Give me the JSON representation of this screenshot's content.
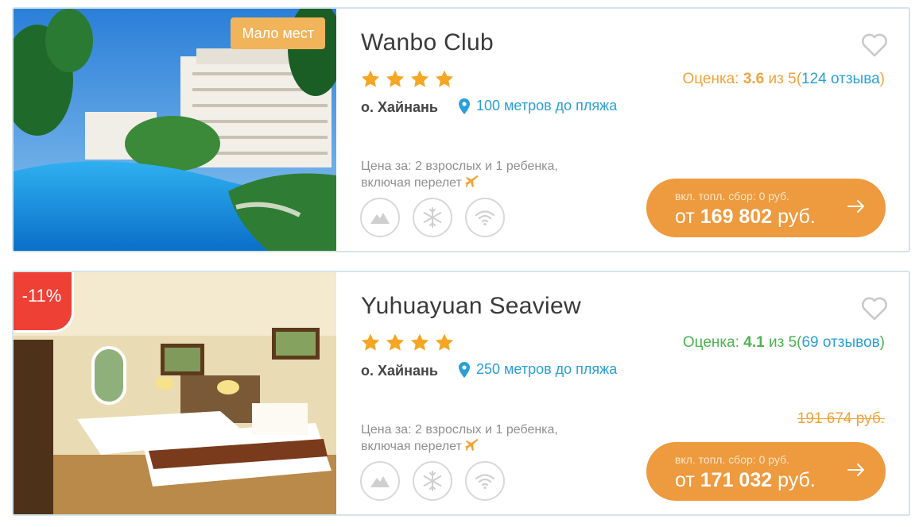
{
  "hotels": [
    {
      "name": "Wanbo Club",
      "badge": "Мало мест",
      "stars": 4,
      "rating_label": "Оценка:",
      "rating_value": "3.6",
      "rating_scale": "из 5",
      "reviews_open": "(",
      "reviews": "124 отзыва",
      "reviews_close": ")",
      "location": "о. Хайнань",
      "beach": "100 метров до пляжа",
      "price_note_1": "Цена за: 2 взрослых и 1 ребенка,",
      "price_note_2": "включая перелет",
      "fee": "вкл. топл. сбор: 0 руб.",
      "price_prefix": "от",
      "price": "169 802",
      "currency": "руб.",
      "old_price": ""
    },
    {
      "name": "Yuhuayuan Seaview",
      "badge": "-11%",
      "stars": 4,
      "rating_label": "Оценка:",
      "rating_value": "4.1",
      "rating_scale": "из 5",
      "reviews_open": "(",
      "reviews": "69 отзывов",
      "reviews_close": ")",
      "location": "о. Хайнань",
      "beach": "250 метров до пляжа",
      "price_note_1": "Цена за: 2 взрослых и 1 ребенка,",
      "price_note_2": "включая перелет",
      "fee": "вкл. топл. сбор: 0 руб.",
      "price_prefix": "от",
      "price": "171 032",
      "currency": "руб.",
      "old_price": "191 674 руб."
    }
  ],
  "icons": {
    "favorite": "heart-icon",
    "star": "star-icon",
    "pin": "map-pin-icon",
    "plane": "airplane-icon",
    "amenities": [
      "mountains-icon",
      "snowflake-icon",
      "wifi-icon"
    ],
    "arrow": "arrow-right-icon"
  },
  "colors": {
    "accent_orange": "#ee9a3e",
    "rating_orange": "#f2a33a",
    "rating_green": "#4cb34e",
    "link_blue": "#2a9fd6",
    "discount_red": "#ee4035",
    "badge_yellow": "#f2b45a"
  }
}
